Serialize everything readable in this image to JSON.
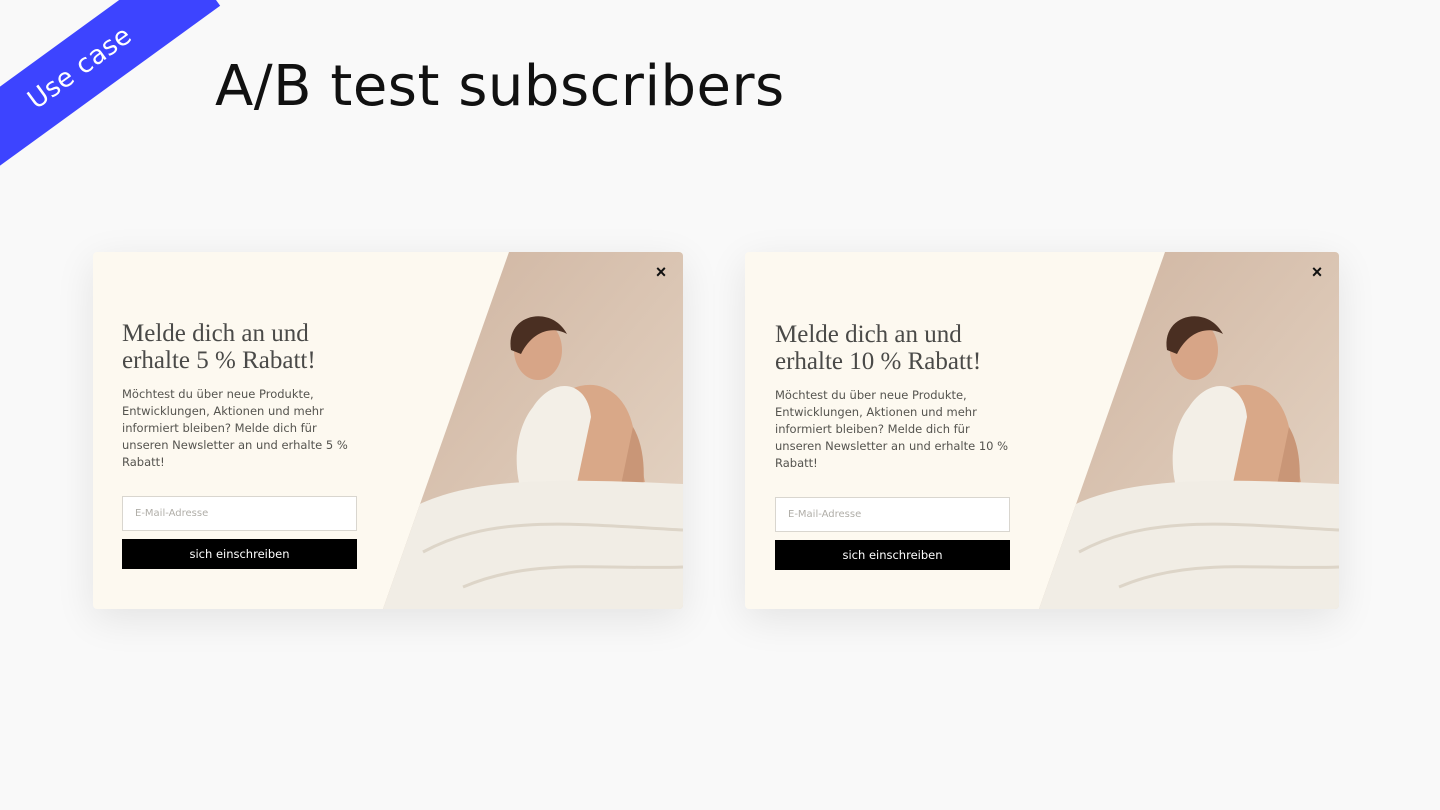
{
  "ribbon": {
    "label": "Use case",
    "color": "#3d44ff"
  },
  "slide": {
    "title": "A/B test subscribers"
  },
  "variants": [
    {
      "close_icon": "×",
      "headline_line1": "Melde dich an und",
      "headline_line2": "erhalte 5 % Rabatt!",
      "body": "Möchtest du über neue Produkte, Entwicklungen, Aktionen und mehr informiert bleiben? Melde dich für unseren Newsletter an und erhalte 5 % Rabatt!",
      "email_placeholder": "E-Mail-Adresse",
      "button_label": "sich einschreiben"
    },
    {
      "close_icon": "×",
      "headline_line1": "Melde dich an und",
      "headline_line2": "erhalte 10 % Rabatt!",
      "body": "Möchtest du über neue Produkte, Entwicklungen, Aktionen und mehr informiert bleiben? Melde dich für unseren Newsletter an und erhalte 10 % Rabatt!",
      "email_placeholder": "E-Mail-Adresse",
      "button_label": "sich einschreiben"
    }
  ],
  "colors": {
    "popup_background": "#fdf9f0",
    "button_background": "#000000",
    "button_text": "#ffffff",
    "headline_text": "#4a4a48"
  },
  "photo": {
    "icon": "woman-hugging-pillow-photo"
  }
}
